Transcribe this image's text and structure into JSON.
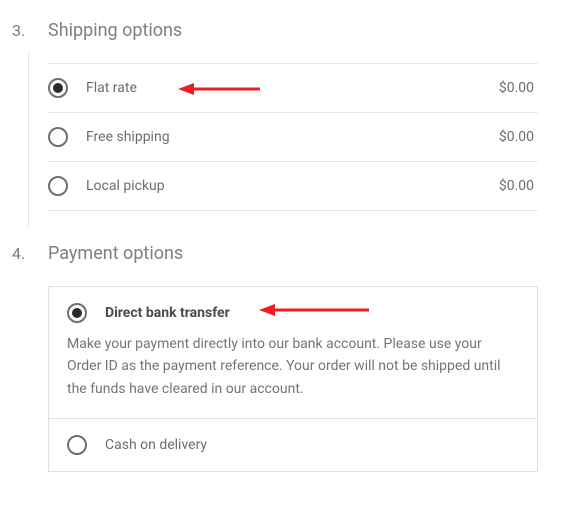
{
  "steps": {
    "shipping": {
      "num": "3.",
      "title": "Shipping options"
    },
    "payment": {
      "num": "4.",
      "title": "Payment options"
    }
  },
  "shipping_options": [
    {
      "label": "Flat rate",
      "price": "$0.00",
      "selected": true
    },
    {
      "label": "Free shipping",
      "price": "$0.00",
      "selected": false
    },
    {
      "label": "Local pickup",
      "price": "$0.00",
      "selected": false
    }
  ],
  "payment_options": [
    {
      "label": "Direct bank transfer",
      "selected": true,
      "desc": "Make your payment directly into our bank account. Please use your Order ID as the payment reference. Your order will not be shipped until the funds have cleared in our account."
    },
    {
      "label": "Cash on delivery",
      "selected": false
    }
  ],
  "annotation_color": "#ee1c25"
}
